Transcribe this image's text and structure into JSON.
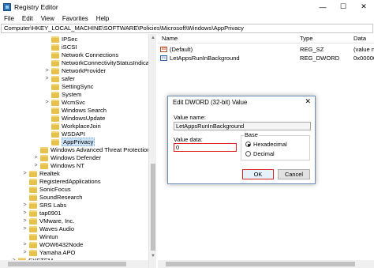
{
  "window": {
    "title": "Registry Editor",
    "controls": {
      "minimize": "—",
      "maximize": "☐",
      "close": "✕"
    }
  },
  "menu": [
    "File",
    "Edit",
    "View",
    "Favorites",
    "Help"
  ],
  "address": "Computer\\HKEY_LOCAL_MACHINE\\SOFTWARE\\Policies\\Microsoft\\Windows\\AppPrivacy",
  "tree": [
    {
      "label": "IPSec",
      "expander": ""
    },
    {
      "label": "iSCSI",
      "expander": ""
    },
    {
      "label": "Network Connections",
      "expander": ""
    },
    {
      "label": "NetworkConnectivityStatusIndicator",
      "expander": ""
    },
    {
      "label": "NetworkProvider",
      "expander": ">"
    },
    {
      "label": "safer",
      "expander": ">"
    },
    {
      "label": "SettingSync",
      "expander": ""
    },
    {
      "label": "System",
      "expander": ""
    },
    {
      "label": "WcmSvc",
      "expander": ">"
    },
    {
      "label": "Windows Search",
      "expander": ""
    },
    {
      "label": "WindowsUpdate",
      "expander": ""
    },
    {
      "label": "WorkplaceJoin",
      "expander": ""
    },
    {
      "label": "WSDAPI",
      "expander": ""
    },
    {
      "label": "AppPrivacy",
      "expander": "",
      "selected": true
    },
    {
      "label": "Windows Advanced Threat Protection",
      "expander": ""
    },
    {
      "label": "Windows Defender",
      "expander": ">"
    },
    {
      "label": "Windows NT",
      "expander": ">"
    },
    {
      "label": "Realtek",
      "expander": ">"
    },
    {
      "label": "RegisteredApplications",
      "expander": ""
    },
    {
      "label": "SonicFocus",
      "expander": ""
    },
    {
      "label": "SoundResearch",
      "expander": ""
    },
    {
      "label": "SRS Labs",
      "expander": ">"
    },
    {
      "label": "tap0901",
      "expander": ">"
    },
    {
      "label": "VMware, Inc.",
      "expander": ">"
    },
    {
      "label": "Waves Audio",
      "expander": ">"
    },
    {
      "label": "Wintun",
      "expander": ""
    },
    {
      "label": "WOW6432Node",
      "expander": ">"
    },
    {
      "label": "Yamaha APO",
      "expander": ">"
    },
    {
      "label": "SYSTEM",
      "expander": ">"
    }
  ],
  "list": {
    "columns": [
      "Name",
      "Type",
      "Data"
    ],
    "rows": [
      {
        "icon": "ab",
        "name": "(Default)",
        "type": "REG_SZ",
        "data": "(value n"
      },
      {
        "icon": "01",
        "name": "LetAppsRunInBackground",
        "type": "REG_DWORD",
        "data": "0x00000"
      }
    ]
  },
  "dialog": {
    "title": "Edit DWORD (32-bit) Value",
    "close": "✕",
    "value_name_label": "Value name:",
    "value_name": "LetAppsRunInBackground",
    "value_data_label": "Value data:",
    "value_data": "0",
    "base_label": "Base",
    "base_options": [
      "Hexadecimal",
      "Decimal"
    ],
    "base_selected": "Hexadecimal",
    "ok": "OK",
    "cancel": "Cancel"
  },
  "colors": {
    "highlight": "#dd2222",
    "folder": "#e7c24a",
    "selection": "#cce4f7"
  }
}
